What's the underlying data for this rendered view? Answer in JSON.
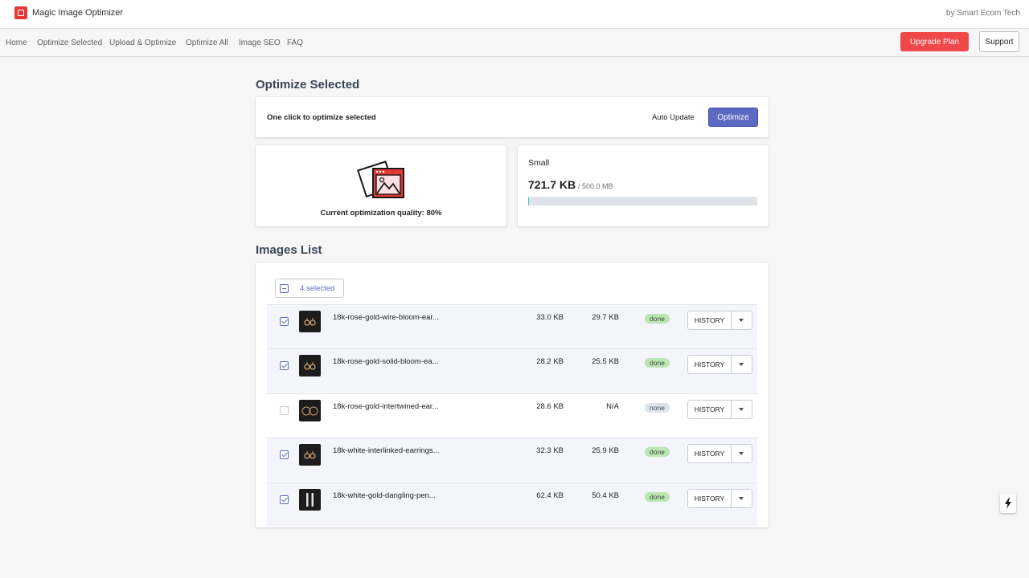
{
  "app": {
    "title": "Magic Image Optimizer",
    "byline": "by Smart Ecom Tech"
  },
  "nav": {
    "items": [
      "Home",
      "Optimize Selected",
      "Upload & Optimize",
      "Optimize All",
      "Image SEO",
      "FAQ"
    ],
    "upgrade_label": "Upgrade Plan",
    "support_label": "Support"
  },
  "optimize": {
    "heading": "Optimize Selected",
    "one_click_text": "One click to optimize selected",
    "auto_update_label": "Auto Update",
    "optimize_button": "Optimize"
  },
  "quality": {
    "text": "Current optimization quality: 80%"
  },
  "size": {
    "label": "Small",
    "used": "721.7 KB",
    "total": "/ 500.0 MB",
    "usage_percent": 0.14
  },
  "images": {
    "heading": "Images List",
    "selected_label": "4 selected",
    "rows": [
      {
        "checked": true,
        "filename": "18k-rose-gold-wire-bloom-ear...",
        "original": "33.0 KB",
        "optimized": "29.7 KB",
        "status": "done",
        "history": "HISTORY",
        "thumb_icon": "earrings-icon"
      },
      {
        "checked": true,
        "filename": "18k-rose-gold-solid-bloom-ea...",
        "original": "28.2 KB",
        "optimized": "25.5 KB",
        "status": "done",
        "history": "HISTORY",
        "thumb_icon": "earrings-icon"
      },
      {
        "checked": false,
        "filename": "18k-rose-gold-intertwined-ear...",
        "original": "28.6 KB",
        "optimized": "N/A",
        "status": "none",
        "history": "HISTORY",
        "thumb_icon": "hoop-earrings-icon"
      },
      {
        "checked": true,
        "filename": "18k-white-interlinked-earrings...",
        "original": "32.3 KB",
        "optimized": "25.9 KB",
        "status": "done",
        "history": "HISTORY",
        "thumb_icon": "earrings-icon"
      },
      {
        "checked": true,
        "filename": "18k-white-gold-dangling-pen...",
        "original": "62.4 KB",
        "optimized": "50.4 KB",
        "status": "done",
        "history": "HISTORY",
        "thumb_icon": "pendant-earrings-icon"
      }
    ]
  },
  "colors": {
    "accent": "#5c6ac4",
    "upgrade": "#f04848",
    "done_badge": "#bbe5b3",
    "none_badge": "#dfe3e8",
    "progress": "#47c1bf"
  }
}
